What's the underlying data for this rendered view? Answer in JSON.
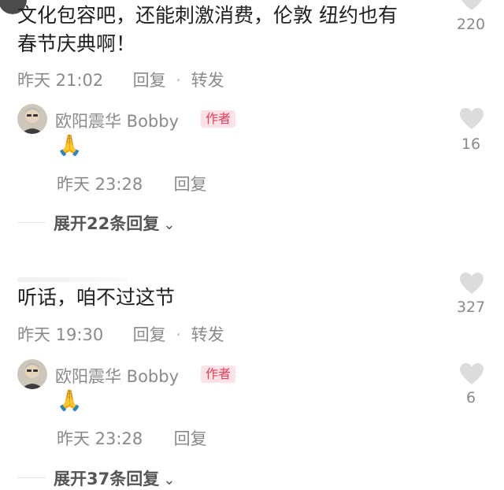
{
  "colors": {
    "text": "#1f1f1f",
    "meta": "#8a8a8a",
    "like_icon": "#dcdcdc",
    "author_badge_bg": "#fde3e7",
    "author_badge_text": "#ee3b55"
  },
  "comments": [
    {
      "text_line1": "文化包容吧，还能刺激消费，伦敦 纽约也有",
      "text_line2": "春节庆典啊！",
      "time": "昨天 21:02",
      "reply_label": "回复",
      "separator": "·",
      "forward_label": "转发",
      "like_icon": "heart-icon",
      "likes": "220",
      "author_reply": {
        "avatar_icon": "avatar-icon",
        "name": "欧阳震华 Bobby",
        "badge": "作者",
        "emoji": "🙏",
        "time": "昨天 23:28",
        "reply_label": "回复",
        "like_icon": "heart-icon",
        "likes": "16"
      },
      "expand_label": "展开22条回复",
      "expand_icon": "chevron-down-icon"
    },
    {
      "text_line1": "听话，咱不过这节",
      "time": "昨天 19:30",
      "reply_label": "回复",
      "separator": "·",
      "forward_label": "转发",
      "like_icon": "heart-icon",
      "likes": "327",
      "author_reply": {
        "avatar_icon": "avatar-icon",
        "name": "欧阳震华 Bobby",
        "badge": "作者",
        "emoji": "🙏",
        "time": "昨天 23:28",
        "reply_label": "回复",
        "like_icon": "heart-icon",
        "likes": "6"
      },
      "expand_label": "展开37条回复",
      "expand_icon": "chevron-down-icon"
    }
  ]
}
